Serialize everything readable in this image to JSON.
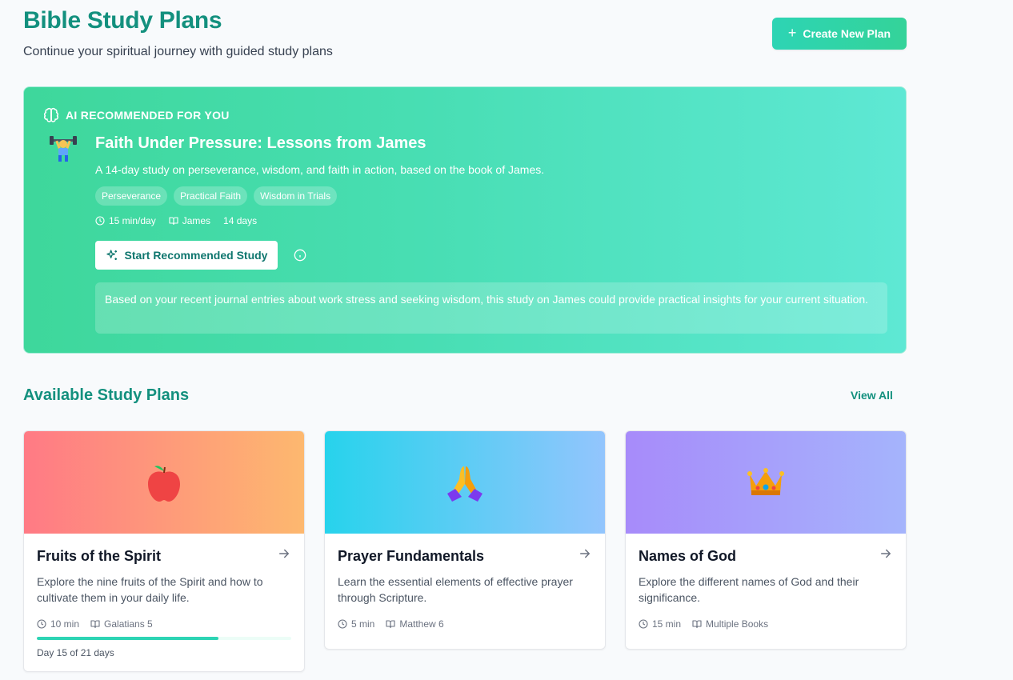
{
  "header": {
    "title": "Bible Study Plans",
    "subtitle": "Continue your spiritual journey with guided study plans",
    "create_button": "Create New Plan"
  },
  "recommended": {
    "label": "AI RECOMMENDED FOR YOU",
    "title": "Faith Under Pressure: Lessons from James",
    "description": "A 14-day study on perseverance, wisdom, and faith in action, based on the book of James.",
    "tags": [
      "Perseverance",
      "Practical Faith",
      "Wisdom in Trials"
    ],
    "time": "15 min/day",
    "book": "James",
    "duration": "14 days",
    "start_button": "Start Recommended Study",
    "reason": "Based on your recent journal entries about work stress and seeking wisdom, this study on James could provide practical insights for your current situation.",
    "emoji_icon": "weightlifter-icon"
  },
  "section": {
    "title": "Available Study Plans",
    "view_all": "View All"
  },
  "plans": [
    {
      "title": "Fruits of the Spirit",
      "description": "Explore the nine fruits of the Spirit and how to cultivate them in your daily life.",
      "time": "10 min",
      "book": "Galatians 5",
      "progress_fraction": 0.714,
      "progress_text": "Day 15 of 21 days",
      "icon": "apple-icon",
      "gradient": [
        "#ff7a85",
        "#fdb86f"
      ]
    },
    {
      "title": "Prayer Fundamentals",
      "description": "Learn the essential elements of effective prayer through Scripture.",
      "time": "5 min",
      "book": "Matthew 6",
      "icon": "praying-hands-icon",
      "gradient": [
        "#27d3ec",
        "#93c5fd"
      ]
    },
    {
      "title": "Names of God",
      "description": "Explore the different names of God and their significance.",
      "time": "15 min",
      "book": "Multiple Books",
      "icon": "crown-icon",
      "gradient": [
        "#a78bfa",
        "#a5b4fc"
      ]
    }
  ],
  "colors": {
    "brand": "#13907e",
    "accent": "#2dd4b4"
  }
}
